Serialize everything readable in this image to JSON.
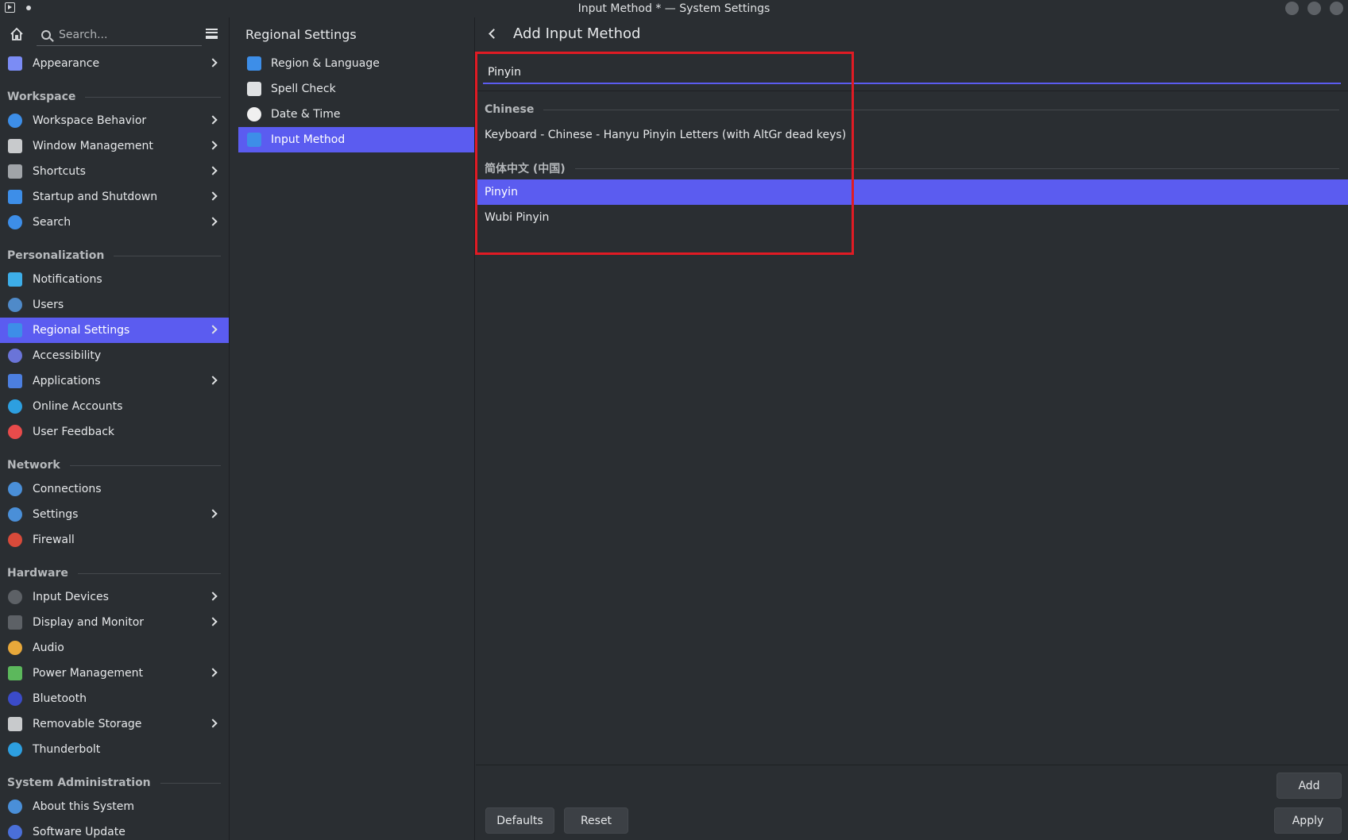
{
  "window": {
    "title": "Input Method * — System Settings"
  },
  "sidebar": {
    "search_placeholder": "Search...",
    "items": [
      {
        "label": "Appearance",
        "icon": "appearance-icon",
        "color": "#7b8cf5",
        "chevron": true
      },
      {
        "section": "Workspace"
      },
      {
        "label": "Workspace Behavior",
        "icon": "workspace-behavior-icon",
        "color": "#3d8ee8",
        "chevron": true
      },
      {
        "label": "Window Management",
        "icon": "window-management-icon",
        "color": "#c8cacc",
        "chevron": true
      },
      {
        "label": "Shortcuts",
        "icon": "keyboard-icon",
        "color": "#a0a4a8",
        "chevron": true
      },
      {
        "label": "Startup and Shutdown",
        "icon": "startup-icon",
        "color": "#3d8ee8",
        "chevron": true
      },
      {
        "label": "Search",
        "icon": "search-icon",
        "color": "#3d8ee8",
        "chevron": true
      },
      {
        "section": "Personalization"
      },
      {
        "label": "Notifications",
        "icon": "notifications-icon",
        "color": "#3daee9",
        "chevron": false
      },
      {
        "label": "Users",
        "icon": "users-icon",
        "color": "#4f8ac9",
        "chevron": false
      },
      {
        "label": "Regional Settings",
        "icon": "regional-settings-icon",
        "color": "#3d8ee8",
        "chevron": true,
        "active": true
      },
      {
        "label": "Accessibility",
        "icon": "accessibility-icon",
        "color": "#6a74d8",
        "chevron": false
      },
      {
        "label": "Applications",
        "icon": "applications-icon",
        "color": "#4c7fe0",
        "chevron": true
      },
      {
        "label": "Online Accounts",
        "icon": "online-accounts-icon",
        "color": "#2d9fe0",
        "chevron": false
      },
      {
        "label": "User Feedback",
        "icon": "user-feedback-icon",
        "color": "#e84b4b",
        "chevron": false
      },
      {
        "section": "Network"
      },
      {
        "label": "Connections",
        "icon": "connections-icon",
        "color": "#4a8fd8",
        "chevron": false
      },
      {
        "label": "Settings",
        "icon": "network-settings-icon",
        "color": "#4a8fd8",
        "chevron": true
      },
      {
        "label": "Firewall",
        "icon": "firewall-icon",
        "color": "#d84a3a",
        "chevron": false
      },
      {
        "section": "Hardware"
      },
      {
        "label": "Input Devices",
        "icon": "mouse-icon",
        "color": "#5d6166",
        "chevron": true
      },
      {
        "label": "Display and Monitor",
        "icon": "display-icon",
        "color": "#5d6166",
        "chevron": true
      },
      {
        "label": "Audio",
        "icon": "audio-icon",
        "color": "#e8a83a",
        "chevron": false
      },
      {
        "label": "Power Management",
        "icon": "battery-icon",
        "color": "#5cb85c",
        "chevron": true
      },
      {
        "label": "Bluetooth",
        "icon": "bluetooth-icon",
        "color": "#3b4bc8",
        "chevron": false
      },
      {
        "label": "Removable Storage",
        "icon": "removable-storage-icon",
        "color": "#c8cacc",
        "chevron": true
      },
      {
        "label": "Thunderbolt",
        "icon": "thunderbolt-icon",
        "color": "#2d9fe0",
        "chevron": false
      },
      {
        "section": "System Administration"
      },
      {
        "label": "About this System",
        "icon": "about-icon",
        "color": "#4a8fd8",
        "chevron": false
      },
      {
        "label": "Software Update",
        "icon": "software-update-icon",
        "color": "#4a6fd8",
        "chevron": false
      }
    ]
  },
  "midcol": {
    "title": "Regional Settings",
    "items": [
      {
        "label": "Region & Language",
        "icon": "region-language-icon",
        "color": "#3d8ee8"
      },
      {
        "label": "Spell Check",
        "icon": "spell-check-icon",
        "color": "#dfe1e3"
      },
      {
        "label": "Date & Time",
        "icon": "clock-icon",
        "color": "#f0f0f0"
      },
      {
        "label": "Input Method",
        "icon": "input-method-icon",
        "color": "#3d8ee8",
        "active": true
      }
    ]
  },
  "main": {
    "title": "Add Input Method",
    "search_value": "Pinyin",
    "groups": [
      {
        "header": "Chinese",
        "items": [
          "Keyboard - Chinese - Hanyu Pinyin Letters (with AltGr dead keys)"
        ]
      },
      {
        "header": "简体中文 (中国)",
        "items": [
          "Pinyin",
          "Wubi Pinyin"
        ]
      }
    ],
    "selected_item": "Pinyin",
    "add_label": "Add",
    "defaults_label": "Defaults",
    "reset_label": "Reset",
    "apply_label": "Apply"
  },
  "colors": {
    "accent": "#5b5cf0",
    "highlight_box": "#e01b24",
    "background": "#2a2e32"
  }
}
